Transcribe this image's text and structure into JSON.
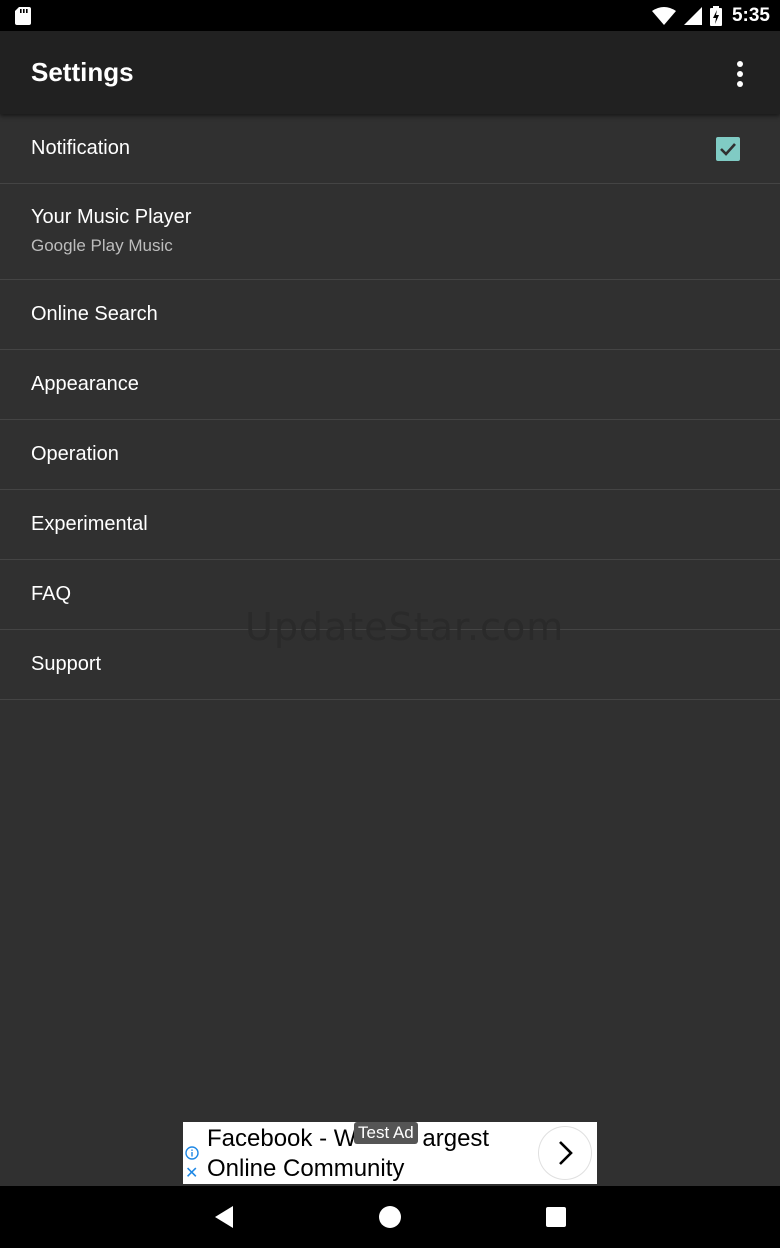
{
  "status_bar": {
    "time": "5:35",
    "icons": [
      "sd-card-icon",
      "wifi-icon",
      "cell-signal-icon",
      "battery-charging-icon"
    ]
  },
  "app_bar": {
    "title": "Settings",
    "overflow_icon": "more-vert-icon"
  },
  "settings": {
    "items": [
      {
        "title": "Notification",
        "checked": true
      },
      {
        "title": "Your Music Player",
        "summary": "Google Play Music"
      },
      {
        "title": "Online Search"
      },
      {
        "title": "Appearance"
      },
      {
        "title": "Operation"
      },
      {
        "title": "Experimental"
      },
      {
        "title": "FAQ"
      },
      {
        "title": "Support"
      }
    ]
  },
  "watermark": "UpdateStar.com",
  "ad": {
    "badge": "Test Ad",
    "line1": "Facebook - W",
    "line1_end": "argest",
    "line2": "Online Community"
  },
  "nav_bar": {
    "icons": [
      "back-icon",
      "home-icon",
      "recents-icon"
    ]
  },
  "colors": {
    "background": "#303030",
    "app_bar": "#212121",
    "accent": "#80cbc4",
    "divider": "#444444"
  }
}
